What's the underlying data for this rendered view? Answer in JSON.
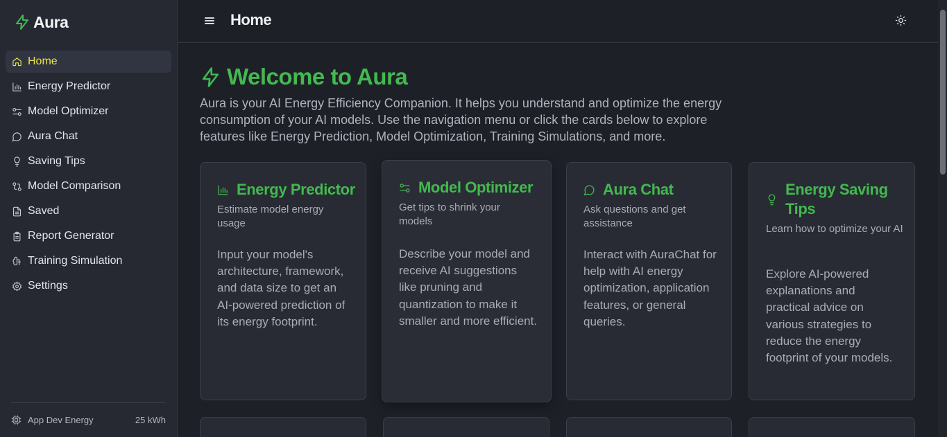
{
  "app": {
    "name": "Aura",
    "accent": "#43b94f",
    "active_color": "#e9e34b"
  },
  "sidebar": {
    "items": [
      {
        "label": "Home",
        "icon": "home-icon",
        "active": true
      },
      {
        "label": "Energy Predictor",
        "icon": "bar-chart-icon"
      },
      {
        "label": "Model Optimizer",
        "icon": "sliders-icon"
      },
      {
        "label": "Aura Chat",
        "icon": "chat-bubble-icon"
      },
      {
        "label": "Saving Tips",
        "icon": "lightbulb-icon"
      },
      {
        "label": "Model Comparison",
        "icon": "compare-arrows-icon"
      },
      {
        "label": "Saved",
        "icon": "file-icon"
      },
      {
        "label": "Report Generator",
        "icon": "clipboard-icon"
      },
      {
        "label": "Training Simulation",
        "icon": "brain-icon"
      },
      {
        "label": "Settings",
        "icon": "gear-icon"
      }
    ],
    "footer": {
      "label": "App Dev Energy",
      "value": "25 kWh",
      "icon": "cpu-icon"
    }
  },
  "header": {
    "title": "Home",
    "menu_icon": "hamburger-menu-icon",
    "theme_icon": "sun-icon"
  },
  "main": {
    "welcome_title": "Welcome to Aura",
    "intro": "Aura is your AI Energy Efficiency Companion. It helps you understand and optimize the energy consumption of your AI models. Use the navigation menu or click the cards below to explore features like Energy Prediction, Model Optimization, Training Simulations, and more.",
    "cards": [
      {
        "title": "Energy Predictor",
        "icon": "bar-chart-icon",
        "subtitle": "Estimate model energy usage",
        "body": "Input your model's architecture, framework, and data size to get an AI-powered prediction of its energy footprint."
      },
      {
        "title": "Model Optimizer",
        "icon": "sliders-icon",
        "subtitle": "Get tips to shrink your models",
        "body": "Describe your model and receive AI suggestions like pruning and quantization to make it smaller and more efficient."
      },
      {
        "title": "Aura Chat",
        "icon": "chat-bubble-icon",
        "subtitle": "Ask questions and get assistance",
        "body": "Interact with AuraChat for help with AI energy optimization, application features, or general queries."
      },
      {
        "title": "Energy Saving Tips",
        "icon": "lightbulb-icon",
        "subtitle": "Learn how to optimize your AI",
        "body": "Explore AI-powered explanations and practical advice on various strategies to reduce the energy footprint of your models."
      }
    ]
  }
}
